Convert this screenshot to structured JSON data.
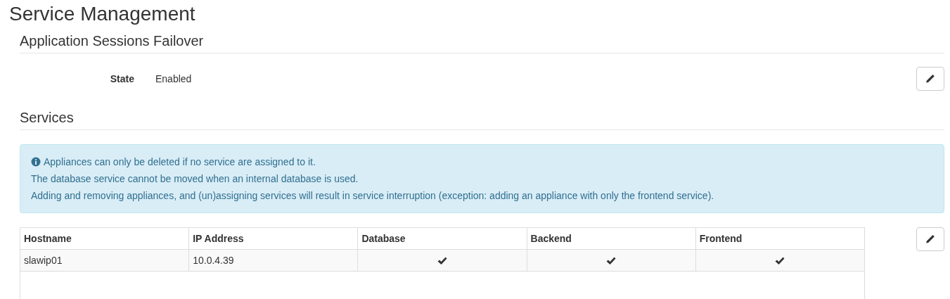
{
  "page_title": "Service Management",
  "failover": {
    "heading": "Application Sessions Failover",
    "fields": [
      {
        "label": "State",
        "value": "Enabled"
      }
    ]
  },
  "services": {
    "heading": "Services",
    "info_lines": [
      "Appliances can only be deleted if no service are assigned to it.",
      "The database service cannot be moved when an internal database is used.",
      "Adding and removing appliances, and (un)assigning services will result in service interruption (exception: adding an appliance with only the frontend service)."
    ],
    "table": {
      "columns": [
        "Hostname",
        "IP Address",
        "Database",
        "Backend",
        "Frontend"
      ],
      "rows": [
        {
          "hostname": "slawip01",
          "ip_address": "10.0.4.39",
          "database": true,
          "backend": true,
          "frontend": true
        }
      ]
    }
  }
}
